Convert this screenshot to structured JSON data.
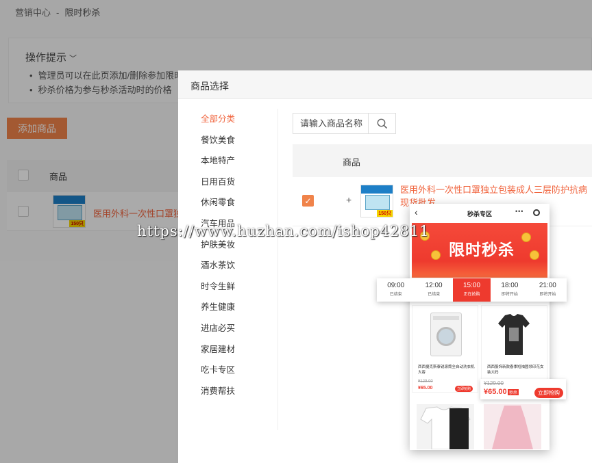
{
  "breadcrumb": {
    "parent": "营销中心",
    "separator": "-",
    "current": "限时秒杀"
  },
  "tips": {
    "title": "操作提示",
    "items": [
      "管理员可以在此页添加/删除参加限时秒杀活动的商品",
      "秒杀价格为参与秒杀活动时的价格"
    ]
  },
  "add_button": "添加商品",
  "bg_table": {
    "col_goods": "商品",
    "row_name": "医用外科一次性口罩独立包装成人三层防护抗病"
  },
  "modal": {
    "title": "商品选择",
    "categories": [
      "全部分类",
      "餐饮美食",
      "本地特产",
      "日用百货",
      "休闲零食",
      "汽车用品",
      "护肤美妆",
      "酒水茶饮",
      "时令生鲜",
      "养生健康",
      "进店必买",
      "家居建材",
      "吃卡专区",
      "消费帮扶"
    ],
    "active_category_index": 0,
    "search": {
      "placeholder": "请输入商品名称"
    },
    "table_header": "商品",
    "row": {
      "plus": "+",
      "name_line1": "医用外科一次性口罩独立包装成人三层防护抗病",
      "name_line2": "现货批发",
      "thumb_pcs": "150只"
    }
  },
  "promo": {
    "page_title": "秒杀专区",
    "banner_text": "限时秒杀",
    "slots": [
      {
        "time": "09:00",
        "status": "已结束"
      },
      {
        "time": "12:00",
        "status": "已结束"
      },
      {
        "time": "15:00",
        "status": "正在抢购"
      },
      {
        "time": "18:00",
        "status": "即将开始"
      },
      {
        "time": "21:00",
        "status": "即将开始"
      }
    ],
    "active_slot_index": 2,
    "products": [
      {
        "name": "西西捷克斯泰锐滚筒全自动洗衣机大容",
        "old": "¥129.00",
        "price": "¥65.00",
        "buy": "立即抢购"
      },
      {
        "name": "西西服饰新款春季短袖圆领印花女装大码",
        "old": "¥129.00",
        "price": "¥65.00",
        "buy": "立即抢购"
      }
    ],
    "popup": {
      "old": "¥129.00",
      "price": "¥65.00",
      "tag": "秒杀",
      "buy": "立即抢购"
    }
  },
  "watermark": "https://www.huzhan.com/ishop42811",
  "colors": {
    "accent": "#f0834a",
    "link": "#f0623b",
    "promo_red": "#ee3a2e"
  }
}
